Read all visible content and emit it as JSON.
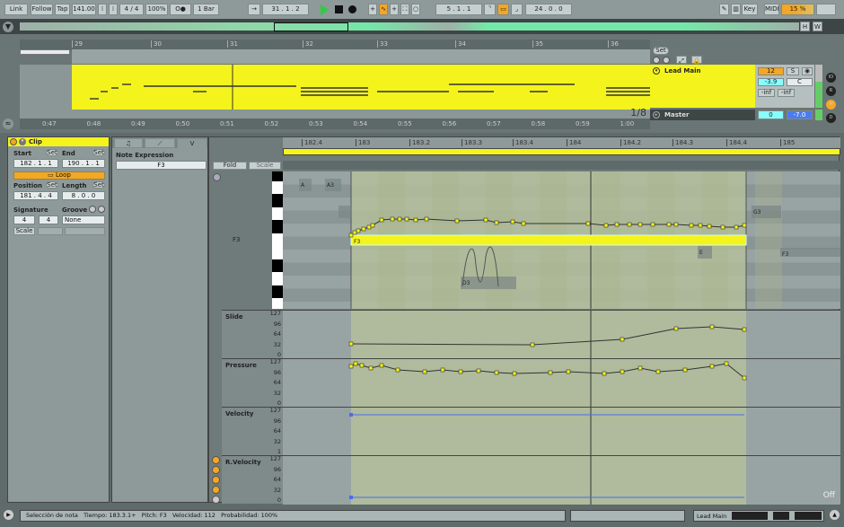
{
  "toolbar": {
    "link": "Link",
    "follow": "Follow",
    "tap": "Tap",
    "tempo": "141.00",
    "signature": "4 / 4",
    "zoom": "100%",
    "metro": "O●",
    "quantize": "1 Bar",
    "position": "31 .  1 .  2",
    "loop_start": "5 .  1 .  1",
    "loop_length": "24 .  0 .  0",
    "key": "Key",
    "midi": "MIDI",
    "cpu": "15 %",
    "accent": "#f5a623"
  },
  "arrangement": {
    "bar_labels": [
      "29",
      "30",
      "31",
      "32",
      "33",
      "34",
      "35",
      "36"
    ],
    "time_labels": [
      "0:47",
      "0:48",
      "0:49",
      "0:50",
      "0:51",
      "0:52",
      "0:53",
      "0:54",
      "0:55",
      "0:56",
      "0:57",
      "0:58",
      "0:59",
      "1:00"
    ],
    "grid": "1/8",
    "set": "Set",
    "track_name": "Lead Main",
    "master_name": "Master",
    "track_number": "12",
    "solo": "S",
    "volume": "-3.9",
    "pan": "C",
    "send_a": "-inf",
    "send_b": "-inf",
    "master_vol": "0",
    "master_level": "-7.0",
    "side_buttons": [
      "IO",
      "R",
      "M",
      "D"
    ],
    "clip_color": "#f4f41c"
  },
  "clip": {
    "title": "Clip",
    "start_label": "Start",
    "end_label": "End",
    "set": "Set",
    "start": "182 .   1 .   1",
    "end": "190 .   1 .   1",
    "loop": "Loop",
    "position_label": "Position",
    "length_label": "Length",
    "position": "181 .   4 .   4",
    "length": "8 .   0 .   0",
    "signature_label": "Signature",
    "groove_label": "Groove",
    "sig_num": "4",
    "sig_den": "4",
    "groove": "None",
    "scale": "Scale"
  },
  "expression": {
    "tabs": [
      "♫",
      "⟋",
      "V"
    ],
    "title": "Note Expression",
    "note": "F3"
  },
  "editor": {
    "fold": "Fold",
    "scale": "Scale",
    "ruler": [
      "182.4",
      "183",
      "183.2",
      "183.3",
      "183.4",
      "184",
      "184.2",
      "184.3",
      "184.4",
      "185"
    ],
    "key_label": "F3",
    "notes": [
      "A",
      "A3",
      "F3",
      "G3",
      "E",
      "F3",
      "D3"
    ],
    "lanes": [
      {
        "name": "Slide",
        "ticks": [
          "127",
          "96",
          "64",
          "32",
          "0"
        ]
      },
      {
        "name": "Pressure",
        "ticks": [
          "127",
          "96",
          "64",
          "32",
          "0"
        ]
      },
      {
        "name": "Velocity",
        "ticks": [
          "127",
          "96",
          "64",
          "32",
          "1"
        ]
      },
      {
        "name": "R.Velocity",
        "ticks": [
          "127",
          "96",
          "64",
          "32",
          "0"
        ]
      }
    ],
    "off": "Off"
  },
  "status": {
    "text": "Selección de nota   Tiempo: 183.3.1+   Pitch: F3   Velocidad: 112   Probabilidad: 100%",
    "track": "Lead Main"
  }
}
